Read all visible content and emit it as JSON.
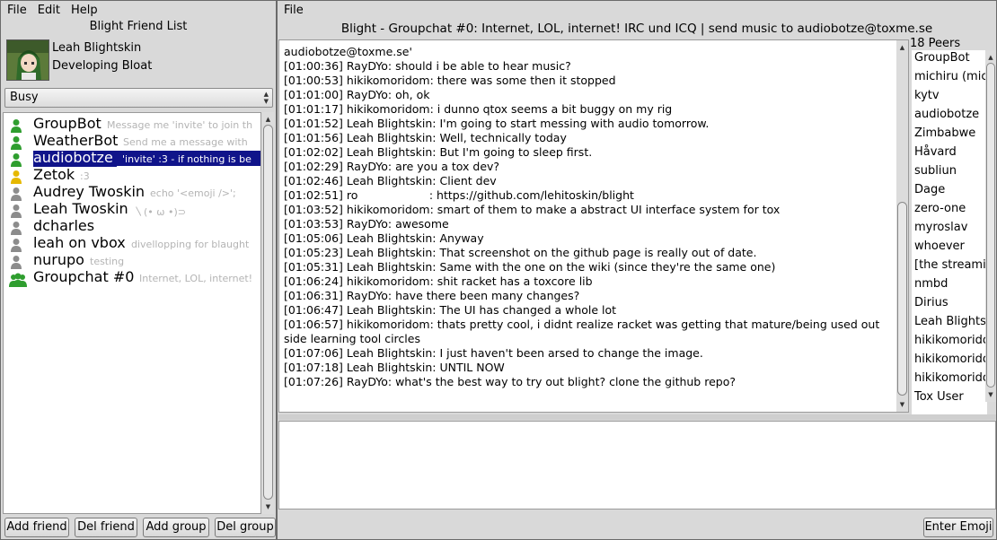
{
  "friend_window": {
    "menu": [
      "File",
      "Edit",
      "Help"
    ],
    "title": "Blight Friend List",
    "profile": {
      "name": "Leah Blightskin",
      "status_message": "Developing Bloat"
    },
    "status_select": "Busy",
    "friends": [
      {
        "name": "GroupBot",
        "message": "Message me 'invite' to join th",
        "status": "online",
        "color": "#2f9e2f"
      },
      {
        "name": "WeatherBot",
        "message": "Send me a message with",
        "status": "online",
        "color": "#2f9e2f"
      },
      {
        "name": "audiobotze",
        "message": "'invite' :3  - if nothing is be",
        "status": "online",
        "color": "#2f9e2f",
        "selected": true
      },
      {
        "name": "Zetok",
        "message": ":3",
        "status": "away",
        "color": "#e6b800"
      },
      {
        "name": "Audrey Twoskin",
        "message": "echo '<emoji />';",
        "status": "offline",
        "color": "#8c8c8c"
      },
      {
        "name": "Leah Twoskin",
        "message": "〵(• ω •)⊃",
        "status": "offline",
        "color": "#8c8c8c"
      },
      {
        "name": "dcharles",
        "message": "",
        "status": "offline",
        "color": "#8c8c8c"
      },
      {
        "name": "leah on vbox",
        "message": "divellopping for blaught",
        "status": "offline",
        "color": "#8c8c8c"
      },
      {
        "name": "nurupo",
        "message": "testing",
        "status": "offline",
        "color": "#8c8c8c"
      },
      {
        "name": "Groupchat #0",
        "message": "Internet, LOL, internet! ",
        "status": "group",
        "color": "#2f9e2f"
      }
    ],
    "buttons": {
      "add_friend": "Add friend",
      "del_friend": "Del friend",
      "add_group": "Add group",
      "del_group": "Del group"
    }
  },
  "chat_window": {
    "menu": [
      "File"
    ],
    "title": "Blight - Groupchat #0: Internet, LOL, internet! IRC und ICQ | send music to audiobotze@toxme.se",
    "messages": [
      "audiobotze@toxme.se'",
      "[01:00:36] RayDYo: should i be able to hear music?",
      "[01:00:53] hikikomoridom: there was some then it stopped",
      "[01:01:00] RayDYo: oh, ok",
      "[01:01:17] hikikomoridom: i dunno qtox seems a bit buggy on my rig",
      "[01:01:52] Leah Blightskin: I'm going to start messing with audio tomorrow.",
      "[01:01:56] Leah Blightskin: Well, technically today",
      "[01:02:02] Leah Blightskin: But I'm going to sleep first.",
      "[01:02:29] RayDYo: are you a tox dev?",
      "[01:02:46] Leah Blightskin: Client dev",
      "[01:02:51] ro                    : https://github.com/lehitoskin/blight",
      "[01:03:52] hikikomoridom: smart of them to make a abstract UI interface system for tox",
      "[01:03:53] RayDYo: awesome",
      "[01:05:06] Leah Blightskin: Anyway",
      "[01:05:23] Leah Blightskin: That screenshot on the github page is really out of date.",
      "[01:05:31] Leah Blightskin: Same with the one on the wiki (since they're the same one)",
      "[01:06:24] hikikomoridom: shit racket has a toxcore lib",
      "[01:06:31] RayDYo: have there been many changes?",
      "[01:06:47] Leah Blightskin: The UI has changed a whole lot",
      "[01:06:57] hikikomoridom: thats pretty cool, i didnt realize racket was getting that mature/being used out side learning tool circles",
      "[01:07:06] Leah Blightskin: I just haven't been arsed to change the image.",
      "[01:07:18] Leah Blightskin: UNTIL NOW",
      "[01:07:26] RayDYo: what's the best way to try out blight? clone the github repo?"
    ],
    "peers_header": "18 Peers",
    "peers": [
      "GroupBot",
      "michiru (mic",
      "kytv",
      "audiobotze",
      "Zimbabwe",
      "Håvard",
      "subliun",
      "Dage",
      "zero-one",
      "myroslav",
      "whoever",
      "[the streami",
      "nmbd",
      "Dirius",
      "Leah Blights",
      "hikikomorido",
      "hikikomorido",
      "hikikomorido",
      "Tox User"
    ],
    "input_value": "",
    "emoji_button": "Enter Emoji"
  }
}
